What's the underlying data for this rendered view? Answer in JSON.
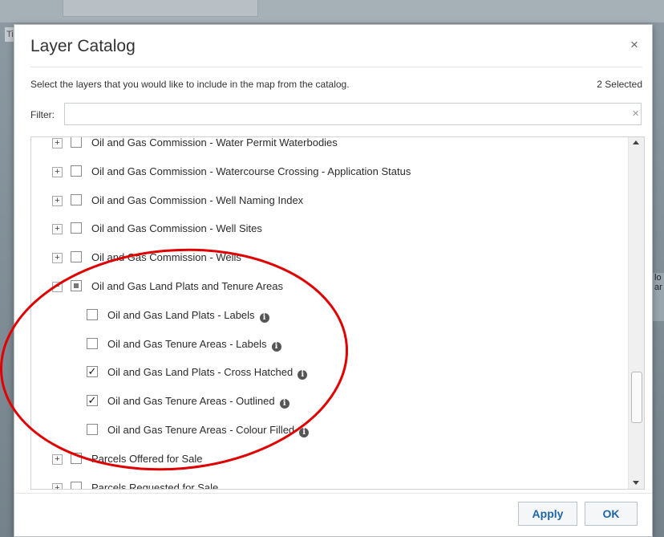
{
  "background": {
    "tip_text": "Tip",
    "right_text_a": "lo",
    "right_text_b": "ar"
  },
  "dialog": {
    "title": "Layer Catalog",
    "close_icon": "×",
    "instructions": "Select the layers that you would like to include in the map from the catalog.",
    "selected_count": "2 Selected",
    "filter_label": "Filter:",
    "filter_value": "",
    "filter_clear_icon": "×"
  },
  "layers": [
    {
      "label": "Oil and Gas Commission - Water Permit Waterbodies",
      "level": 0,
      "expander": "+",
      "checked": false,
      "info": false
    },
    {
      "label": "Oil and Gas Commission - Watercourse Crossing - Application Status",
      "level": 0,
      "expander": "+",
      "checked": false,
      "info": false
    },
    {
      "label": "Oil and Gas Commission - Well Naming Index",
      "level": 0,
      "expander": "+",
      "checked": false,
      "info": false
    },
    {
      "label": "Oil and Gas Commission - Well Sites",
      "level": 0,
      "expander": "+",
      "checked": false,
      "info": false
    },
    {
      "label": "Oil and Gas Commission - Wells",
      "level": 0,
      "expander": "+",
      "checked": false,
      "info": false
    },
    {
      "label": "Oil and Gas Land Plats and Tenure Areas",
      "level": 0,
      "expander": "−",
      "checked": "partial",
      "info": false
    },
    {
      "label": "Oil and Gas Land Plats - Labels",
      "level": 1,
      "checked": false,
      "info": true
    },
    {
      "label": "Oil and Gas Tenure Areas - Labels",
      "level": 1,
      "checked": false,
      "info": true
    },
    {
      "label": "Oil and Gas Land Plats - Cross Hatched",
      "level": 1,
      "checked": true,
      "info": true
    },
    {
      "label": "Oil and Gas Tenure Areas - Outlined",
      "level": 1,
      "checked": true,
      "info": true
    },
    {
      "label": "Oil and Gas Tenure Areas - Colour Filled",
      "level": 1,
      "checked": false,
      "info": true
    },
    {
      "label": "Parcels Offered for Sale",
      "level": 0,
      "expander": "+",
      "checked": false,
      "info": false
    },
    {
      "label": "Parcels Requested for Sale",
      "level": 0,
      "expander": "+",
      "checked": false,
      "info": false
    }
  ],
  "icons": {
    "info": "i",
    "check": "✓"
  },
  "buttons": {
    "apply": "Apply",
    "ok": "OK"
  },
  "colors": {
    "button_text": "#1f66a8",
    "annotation": "#e00000"
  }
}
